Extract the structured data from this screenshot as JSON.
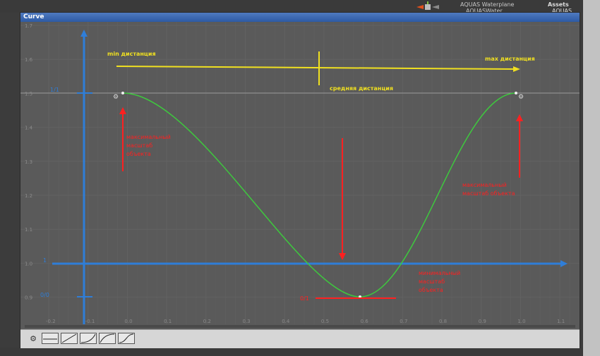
{
  "window": {
    "title": "Curve"
  },
  "project": {
    "items": [
      "AQUAS Waterplane",
      "AQUASWater"
    ],
    "assets_label": "Assets",
    "assets_child": "AQUAS"
  },
  "axes": {
    "x_ticks": [
      "-0.2",
      "-0.1",
      "0.0",
      "0.1",
      "0.2",
      "0.3",
      "0.4",
      "0.5",
      "0.6",
      "0.7",
      "0.8",
      "0.9",
      "1.0",
      "1.1"
    ],
    "y_ticks": [
      "1.7",
      "1.6",
      "1.5",
      "1.4",
      "1.3",
      "1.2",
      "1.1",
      "1.0",
      "0.9"
    ]
  },
  "annotations": {
    "min_distance": "min дистанция",
    "mid_distance": "средняя дистанция",
    "max_distance": "max дистанция",
    "red_left": [
      "максимальный",
      "масштаб",
      "объекта"
    ],
    "red_right": [
      "максимальный",
      "масштаб объекта"
    ],
    "red_bottom": [
      "минимальный",
      "масштаб",
      "объекта"
    ],
    "blue_top": "1/1",
    "blue_mid": "1",
    "blue_bottom": "0/0",
    "red_min_value": "0/1"
  },
  "presets": [
    "constant",
    "linear",
    "ease-in",
    "ease-out",
    "ease-in-out"
  ]
}
